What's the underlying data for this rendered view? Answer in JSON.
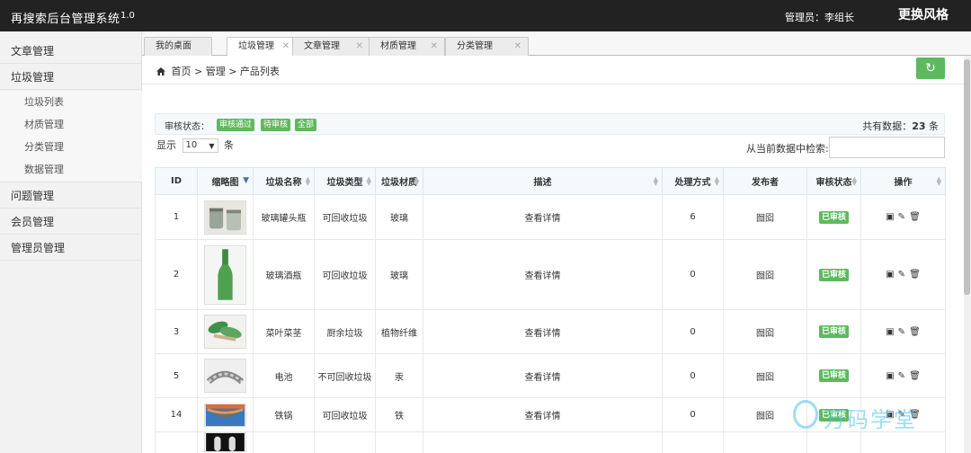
{
  "header": {
    "title": "再搜索后台管理系统",
    "version": "1.0",
    "admin": "管理员：李组长",
    "style_button": "更换风格"
  },
  "sidebar": {
    "items": [
      {
        "label": "文章管理"
      },
      {
        "label": "垃圾管理"
      },
      {
        "label": "问题管理"
      },
      {
        "label": "会员管理"
      },
      {
        "label": "管理员管理"
      }
    ],
    "sub_items": [
      {
        "label": "垃圾列表"
      },
      {
        "label": "材质管理"
      },
      {
        "label": "分类管理"
      },
      {
        "label": "数据管理"
      }
    ]
  },
  "tabs": [
    {
      "label": "我的桌面",
      "active": false
    },
    {
      "label": "垃圾管理",
      "active": true
    },
    {
      "label": "文章管理",
      "active": false
    },
    {
      "label": "材质管理",
      "active": false
    },
    {
      "label": "分类管理",
      "active": false
    }
  ],
  "breadcrumb": "首页 > 管理 > 产品列表",
  "filter": {
    "label": "审核状态：",
    "buttons": [
      "审核通过",
      "待审核",
      "全部"
    ],
    "total_prefix": "共有数据：",
    "total_count": "23",
    "total_suffix": " 条"
  },
  "page_size": {
    "prefix": "显示",
    "value": "10",
    "suffix": "条"
  },
  "search": {
    "label": "从当前数据中检索:",
    "value": ""
  },
  "table": {
    "headers": [
      "ID",
      "缩略图",
      "垃圾名称",
      "垃圾类型",
      "垃圾材质",
      "描述",
      "处理方式",
      "发布者",
      "审核状态",
      "操作"
    ],
    "rows": [
      {
        "id": "1",
        "name": "玻璃罐头瓶",
        "type": "可回收垃圾",
        "material": "玻璃",
        "desc": "查看详情",
        "method": "6",
        "publisher": "囫囵",
        "status": "已审核"
      },
      {
        "id": "2",
        "name": "玻璃酒瓶",
        "type": "可回收垃圾",
        "material": "玻璃",
        "desc": "查看详情",
        "method": "0",
        "publisher": "囫囵",
        "status": "已审核"
      },
      {
        "id": "3",
        "name": "菜叶菜茎",
        "type": "厨余垃圾",
        "material": "植物纤维",
        "desc": "查看详情",
        "method": "0",
        "publisher": "囫囵",
        "status": "已审核"
      },
      {
        "id": "5",
        "name": "电池",
        "type": "不可回收垃圾",
        "material": "汞",
        "desc": "查看详情",
        "method": "0",
        "publisher": "囫囵",
        "status": "已审核"
      },
      {
        "id": "14",
        "name": "铁锅",
        "type": "可回收垃圾",
        "material": "铁",
        "desc": "查看详情",
        "method": "0",
        "publisher": "囫囵",
        "status": "已审核"
      },
      {
        "id": "",
        "name": "",
        "type": "",
        "material": "",
        "desc": "",
        "method": "",
        "publisher": "",
        "status": ""
      }
    ]
  },
  "watermark": "万码学堂",
  "colors": {
    "header_bg": "#222222",
    "accent_green": "#5eb95e",
    "sidebar_bg": "#f2f2f2"
  }
}
